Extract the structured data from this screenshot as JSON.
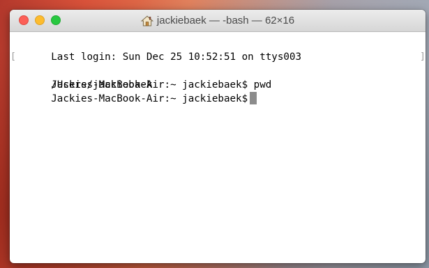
{
  "window": {
    "title": "jackiebaek — -bash — 62×16",
    "title_icon": "home-icon"
  },
  "terminal": {
    "lines": [
      "Last login: Sun Dec 25 10:52:51 on ttys003",
      "Jackies-MacBook-Air:~ jackiebaek$ pwd",
      "/Users/jackiebaek",
      "Jackies-MacBook-Air:~ jackiebaek$"
    ],
    "mark_left": "[",
    "mark_right": "]"
  },
  "colors": {
    "close": "#fc5f57",
    "minimize": "#fdbc2e",
    "zoom": "#28c840",
    "cursor": "#8c8c8c"
  }
}
